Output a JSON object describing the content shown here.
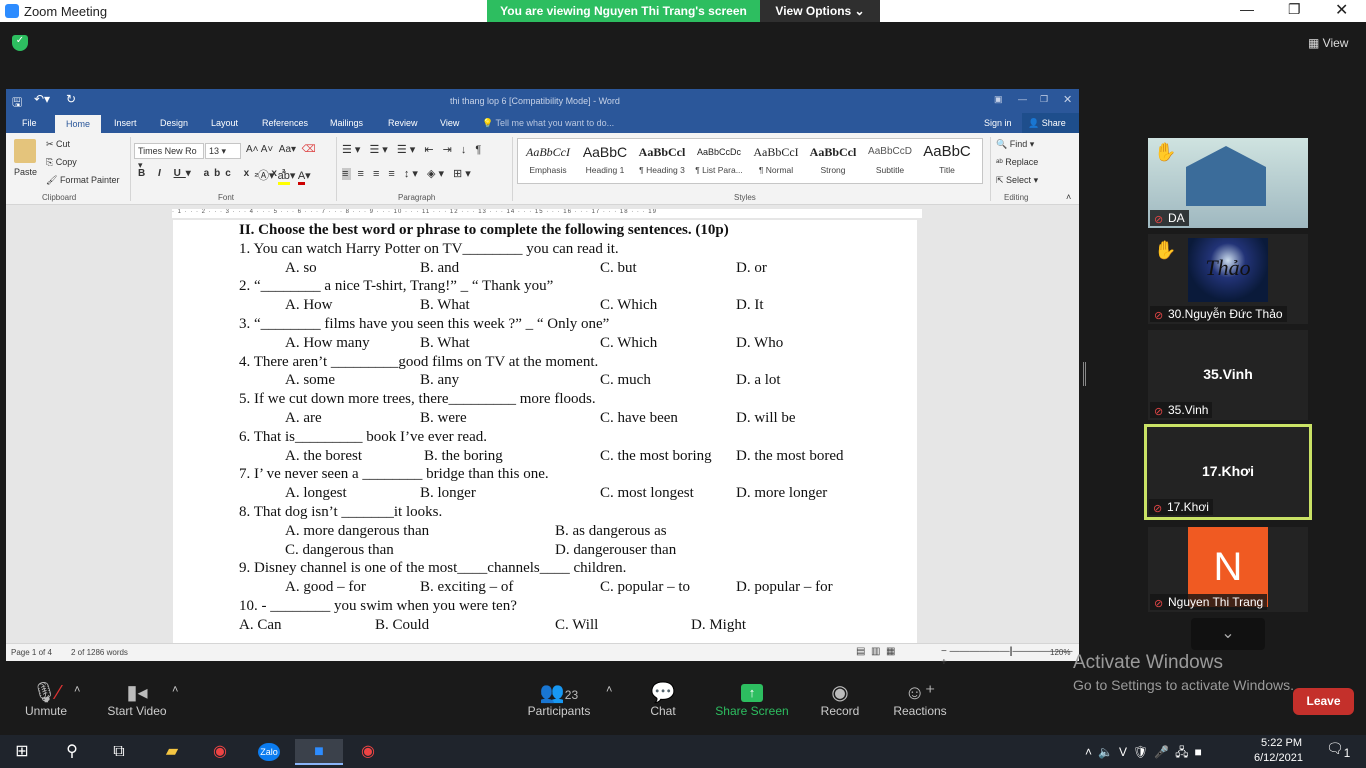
{
  "zoom": {
    "window_title": "Zoom Meeting",
    "banner": "You are viewing Nguyen Thi Trang's screen",
    "view_options": "View Options",
    "view": "View",
    "activate_title": "Activate Windows",
    "activate_sub": "Go to Settings to activate Windows.",
    "leave": "Leave",
    "toolbar": {
      "unmute": "Unmute",
      "start_video": "Start Video",
      "participants": "Participants",
      "participants_count": "23",
      "chat": "Chat",
      "share_screen": "Share Screen",
      "record": "Record",
      "reactions": "Reactions"
    },
    "participants": [
      {
        "name": "DA",
        "label": "DA"
      },
      {
        "name": "30.Nguyễn Đức Thảo",
        "label": "Thảo"
      },
      {
        "name": "35.Vinh",
        "label": "35.Vinh"
      },
      {
        "name": "17.Khơi",
        "label": "17.Khơi"
      },
      {
        "name": "Nguyen Thi Trang",
        "label": "N"
      }
    ],
    "colors": {
      "banner": "#2dbe60",
      "leave": "#c4302b",
      "active_speaker": "#c9e265",
      "avatar": "#f05a22",
      "share": "#2dbe60"
    }
  },
  "word": {
    "title": "thi thang lop 6 [Compatibility Mode] - Word",
    "tabs": [
      "File",
      "Home",
      "Insert",
      "Design",
      "Layout",
      "References",
      "Mailings",
      "Review",
      "View"
    ],
    "tell_me": "Tell me what you want to do...",
    "sign_in": "Sign in",
    "share": "Share",
    "clipboard": {
      "paste": "Paste",
      "cut": "Cut",
      "copy": "Copy",
      "format_painter": "Format Painter",
      "group": "Clipboard"
    },
    "font": {
      "name": "Times New Ro",
      "size": "13",
      "group": "Font"
    },
    "paragraph_group": "Paragraph",
    "styles": [
      {
        "preview": "AaBbCcI",
        "name": "Emphasis"
      },
      {
        "preview": "AaBbC",
        "name": "Heading 1"
      },
      {
        "preview": "AaBbCcl",
        "name": "¶ Heading 3"
      },
      {
        "preview": "AaBbCcDc",
        "name": "¶ List Para..."
      },
      {
        "preview": "AaBbCcI",
        "name": "¶ Normal"
      },
      {
        "preview": "AaBbCcl",
        "name": "Strong"
      },
      {
        "preview": "AaBbCcD",
        "name": "Subtitle"
      },
      {
        "preview": "AaBbC",
        "name": "Title"
      }
    ],
    "styles_group": "Styles",
    "editing": {
      "find": "Find",
      "replace": "Replace",
      "select": "Select",
      "group": "Editing"
    },
    "status": {
      "page": "Page 1 of 4",
      "words": "2 of 1286 words",
      "zoom": "120%"
    },
    "ruler": "· 1 · · · 2 · · · 3 · · · 4 · · · 5 · · · 6 · · · 7 · · · 8 · · · 9 · · · 10 · · · 11 · · · 12 · · · 13 · · · 14 · · · 15 · · · 16 · · · 17 · · · 18 · · · 19"
  },
  "document": {
    "heading": "II. Choose the best word or phrase to complete the following sentences. (10p)",
    "questions": [
      {
        "stem": "1. You can watch Harry Potter on TV________ you can read it.",
        "rows": [
          [
            "A.  so",
            "B. and",
            "C. but",
            "D.  or"
          ]
        ]
      },
      {
        "stem": "2. “________ a nice T-shirt, Trang!”    _ “ Thank you”",
        "rows": [
          [
            "A. How",
            "B.  What",
            "C.  Which",
            "D.  It"
          ]
        ]
      },
      {
        "stem": "3. “________ films have you seen this week ?” _ “ Only one”",
        "rows": [
          [
            "A.  How many",
            "B.  What",
            "C.  Which",
            "D.  Who"
          ]
        ]
      },
      {
        "stem": "4. There aren’t   _________good films on TV at the moment.",
        "rows": [
          [
            "A.  some ",
            "B. any",
            "C.  much",
            "D.  a lot"
          ]
        ]
      },
      {
        "stem": "5. If we cut down more trees, there_________  more floods.",
        "rows": [
          [
            "A. are",
            "B.  were",
            "C.  have been",
            "D.  will be"
          ]
        ]
      },
      {
        "stem": "6. That is_________ book I’ve ever read.",
        "rows": [
          [
            "A.  the borest",
            "B. the boring",
            "C. the most boring",
            "D. the most bored"
          ]
        ]
      },
      {
        "stem": "7. I’ ve never seen a ________ bridge than this one.",
        "rows": [
          [
            "A. longest",
            "B. longer",
            "C. most longest",
            "D.  more longer"
          ]
        ]
      },
      {
        "stem": "8. That dog isn’t _______it looks.",
        "rows": [
          [
            "A. more dangerous than",
            "B. as dangerous as"
          ],
          [
            "C.  dangerous than",
            "D.  dangerouser than"
          ]
        ]
      },
      {
        "stem": "9. Disney channel is one of the most____channels____ children.",
        "rows": [
          [
            "A. good – for",
            "B. exciting – of",
            "C. popular – to",
            "D. popular – for"
          ]
        ]
      },
      {
        "stem": "10.  - ________ you swim when you were ten?",
        "rows": [
          [
            "A.  Can",
            "B.  Could",
            "C.  Will",
            "D. Might"
          ]
        ]
      }
    ]
  },
  "taskbar": {
    "time": "5:22 PM",
    "date": "6/12/2021",
    "notifications": "1"
  }
}
